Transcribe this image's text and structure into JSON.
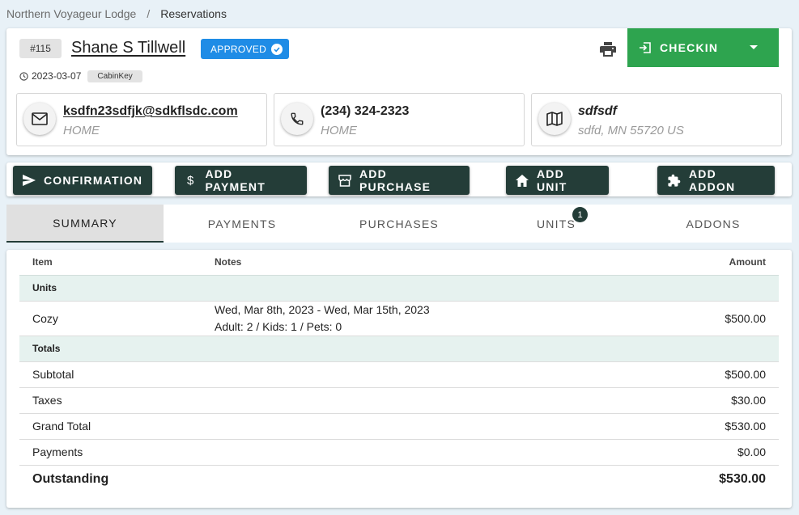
{
  "breadcrumb": {
    "root": "Northern Voyageur Lodge",
    "separator": "/",
    "current": "Reservations"
  },
  "reservation": {
    "id": "#115",
    "guest_name": "Shane S Tillwell",
    "status": "APPROVED",
    "date": "2023-03-07",
    "tag": "CabinKey"
  },
  "actions": {
    "checkin_label": "CHECKIN"
  },
  "contacts": {
    "email": {
      "value": "ksdfn23sdfjk@sdkflsdc.com",
      "type": "HOME"
    },
    "phone": {
      "value": "(234) 324-2323",
      "type": "HOME"
    },
    "address": {
      "value": "sdfsdf",
      "detail": "sdfd, MN 55720 US"
    }
  },
  "buttons": {
    "confirmation": "CONFIRMATION",
    "add_payment": "ADD PAYMENT",
    "add_purchase": "ADD PURCHASE",
    "add_unit": "ADD UNIT",
    "add_addon": "ADD ADDON"
  },
  "tabs": {
    "summary": "SUMMARY",
    "payments": "PAYMENTS",
    "purchases": "PURCHASES",
    "units": "UNITS",
    "units_count": "1",
    "addons": "ADDONS"
  },
  "summary": {
    "headers": {
      "item": "Item",
      "notes": "Notes",
      "amount": "Amount"
    },
    "units_group": "Units",
    "unit": {
      "name": "Cozy",
      "dates": "Wed, Mar 8th, 2023 - Wed, Mar 15th, 2023",
      "guests": "Adult: 2 / Kids: 1 / Pets: 0",
      "amount": "$500.00"
    },
    "totals_group": "Totals",
    "subtotal": {
      "label": "Subtotal",
      "amount": "$500.00"
    },
    "taxes": {
      "label": "Taxes",
      "amount": "$30.00"
    },
    "grand_total": {
      "label": "Grand Total",
      "amount": "$530.00"
    },
    "payments": {
      "label": "Payments",
      "amount": "$0.00"
    },
    "outstanding": {
      "label": "Outstanding",
      "amount": "$530.00"
    }
  },
  "colors": {
    "status_badge": "#1f8ce6",
    "checkin": "#2ea44f",
    "action_button": "#243d38",
    "group_row": "#e6f2ef"
  }
}
